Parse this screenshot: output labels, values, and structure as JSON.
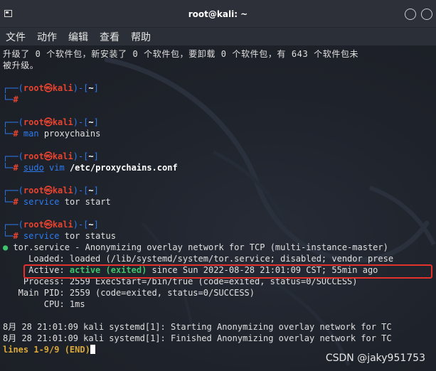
{
  "window": {
    "title": "root@kali: ~"
  },
  "menu": [
    "文件",
    "动作",
    "编辑",
    "查看",
    "帮助"
  ],
  "terminal": {
    "upgrade_line1": "升级了 0 个软件包，新安装了 0 个软件包，要卸载 0 个软件包，有 643 个软件包未",
    "upgrade_line2": "被升级。",
    "prompt": {
      "top_left": "┌──(",
      "user": "root",
      "at": "㉿",
      "host": "kali",
      "mid": ")-[",
      "path": "~",
      "end": "]",
      "bottom": "└─",
      "hash": "#"
    },
    "commands": [
      {
        "cmd": "",
        "args": ""
      },
      {
        "cmd": "man",
        "args": " proxychains"
      },
      {
        "cmd": "sudo",
        "cmd2": " vim",
        "args": " /etc/proxychains.conf"
      },
      {
        "cmd": "service",
        "args": " tor start"
      },
      {
        "cmd": "service",
        "args": " tor status"
      }
    ],
    "status": {
      "bullet": "●",
      "unit_line": " tor.service - Anonymizing overlay network for TCP (multi-instance-master)",
      "loaded_line": "     Loaded: loaded (/lib/systemd/system/tor.service; disabled; vendor prese",
      "active_label": "     Active: ",
      "active_state": "active (exited)",
      "active_rest": " since Sun 2022-08-28 21:01:09 CST; 55min ago",
      "process_line": "    Process: 2559 ExecStart=/bin/true (code=exited, status=0/SUCCESS)",
      "mainpid_line": "   Main PID: 2559 (code=exited, status=0/SUCCESS)",
      "cpu_line": "        CPU: 1ms"
    },
    "journal": [
      "8月 28 21:01:09 kali systemd[1]: Starting Anonymizing overlay network for TC",
      "8月 28 21:01:09 kali systemd[1]: Finished Anonymizing overlay network for TC"
    ],
    "pager": "lines 1-9/9 (END)"
  },
  "watermark": "CSDN @jaky951753"
}
